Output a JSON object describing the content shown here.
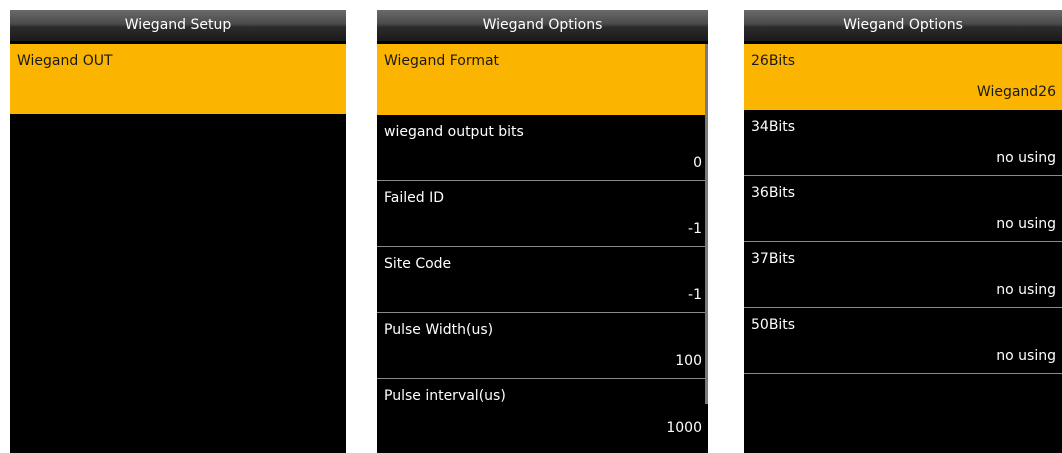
{
  "screen1": {
    "title": "Wiegand Setup",
    "items": [
      {
        "label": "Wiegand OUT"
      }
    ]
  },
  "screen2": {
    "title": "Wiegand Options",
    "items": [
      {
        "label": "Wiegand Format",
        "value": ""
      },
      {
        "label": "wiegand output bits",
        "value": "0"
      },
      {
        "label": "Failed ID",
        "value": "-1"
      },
      {
        "label": "Site Code",
        "value": "-1"
      },
      {
        "label": "Pulse Width(us)",
        "value": "100"
      },
      {
        "label": "Pulse interval(us)",
        "value": "1000"
      }
    ]
  },
  "screen3": {
    "title": "Wiegand Options",
    "items": [
      {
        "label": "26Bits",
        "value": "Wiegand26"
      },
      {
        "label": "34Bits",
        "value": "no using"
      },
      {
        "label": "36Bits",
        "value": "no using"
      },
      {
        "label": "37Bits",
        "value": "no using"
      },
      {
        "label": "50Bits",
        "value": "no using"
      }
    ]
  },
  "colors": {
    "highlight": "#fbb400",
    "background": "#000000",
    "text": "#ffffff"
  }
}
